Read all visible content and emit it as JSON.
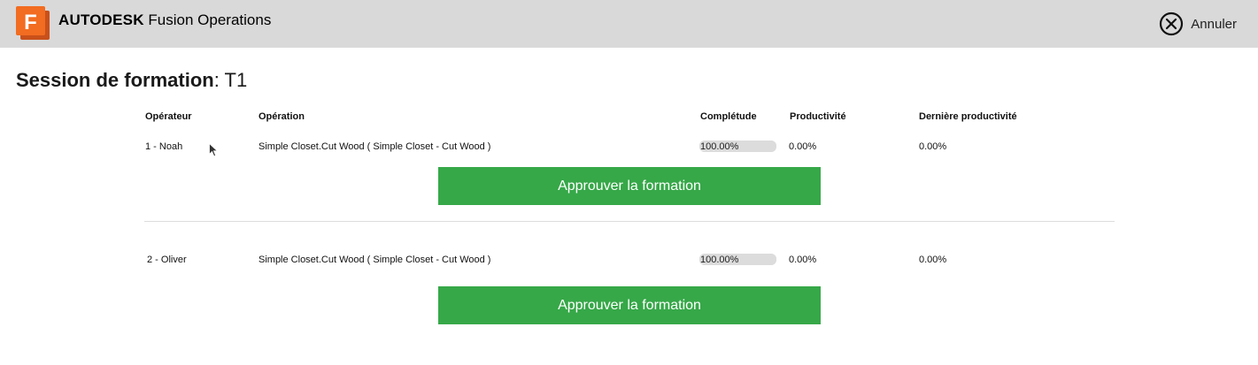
{
  "header": {
    "brand_bold": "AUTODESK",
    "brand_product": "Fusion Operations",
    "logo_letter": "F",
    "logo_icon": "fusion-logo-icon",
    "cancel_label": "Annuler",
    "cancel_icon": "close-circle-icon"
  },
  "session": {
    "label": "Session de formation",
    "separator": ": ",
    "value": "T1"
  },
  "columns": {
    "operator": "Opérateur",
    "operation": "Opération",
    "completion": "Complétude",
    "productivity": "Productivité",
    "last_productivity": "Dernière productivité"
  },
  "rows": [
    {
      "operator": "1 - Noah",
      "operation": "Simple Closet.Cut Wood ( Simple Closet - Cut Wood )",
      "completion_text": "100.00%",
      "completion_value": 1.0,
      "productivity": "0.00%",
      "last_productivity": "0.00%",
      "approve_label": "Approuver la formation"
    },
    {
      "operator": "2 - Oliver",
      "operation": "Simple Closet.Cut Wood ( Simple Closet - Cut Wood )",
      "completion_text": "100.00%",
      "completion_value": 1.0,
      "productivity": "0.00%",
      "last_productivity": "0.00%",
      "approve_label": "Approuver la formation"
    }
  ],
  "colors": {
    "topbar": "#d9d9d9",
    "logo_orange": "#f26c21",
    "logo_dark": "#c9501a",
    "approve_green": "#36a848",
    "progress_track": "#dcdcdc"
  }
}
